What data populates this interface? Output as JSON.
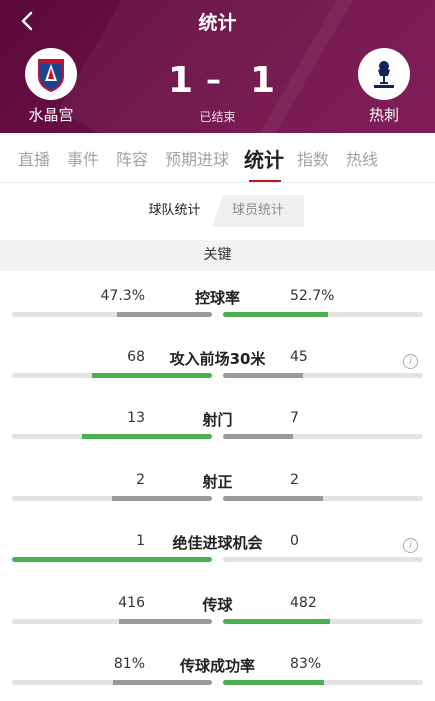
{
  "header": {
    "title": "统计",
    "home_team": "水晶宫",
    "away_team": "热刺",
    "home_score": "1",
    "score_separator": "–",
    "away_score": "1",
    "status": "已结束"
  },
  "tabs": [
    {
      "label": "直播",
      "active": false
    },
    {
      "label": "事件",
      "active": false
    },
    {
      "label": "阵容",
      "active": false
    },
    {
      "label": "预期进球",
      "active": false
    },
    {
      "label": "统计",
      "active": true
    },
    {
      "label": "指数",
      "active": false
    },
    {
      "label": "热线",
      "active": false
    }
  ],
  "segment": {
    "team_stats": "球队统计",
    "player_stats": "球员统计"
  },
  "section_title": "关键",
  "colors": {
    "header_bg": "#6b0f45",
    "winner_bar": "#4caf50",
    "loser_bar": "#9a9a9a",
    "tab_underline": "#b71c1c"
  },
  "stats": [
    {
      "name": "控球率",
      "home": "47.3%",
      "away": "52.7%",
      "home_share": 0.473,
      "away_share": 0.527,
      "leader": "away",
      "info": false
    },
    {
      "name": "攻入前场30米",
      "home": "68",
      "away": "45",
      "home_share": 0.6,
      "away_share": 0.4,
      "leader": "home",
      "info": true
    },
    {
      "name": "射门",
      "home": "13",
      "away": "7",
      "home_share": 0.65,
      "away_share": 0.35,
      "leader": "home",
      "info": false
    },
    {
      "name": "射正",
      "home": "2",
      "away": "2",
      "home_share": 0.5,
      "away_share": 0.5,
      "leader": "none",
      "info": false
    },
    {
      "name": "绝佳进球机会",
      "home": "1",
      "away": "0",
      "home_share": 1.0,
      "away_share": 0.0,
      "leader": "home",
      "info": true
    },
    {
      "name": "传球",
      "home": "416",
      "away": "482",
      "home_share": 0.463,
      "away_share": 0.537,
      "leader": "away",
      "info": false
    },
    {
      "name": "传球成功率",
      "home": "81%",
      "away": "83%",
      "home_share": 0.494,
      "away_share": 0.506,
      "leader": "away",
      "info": false
    }
  ]
}
